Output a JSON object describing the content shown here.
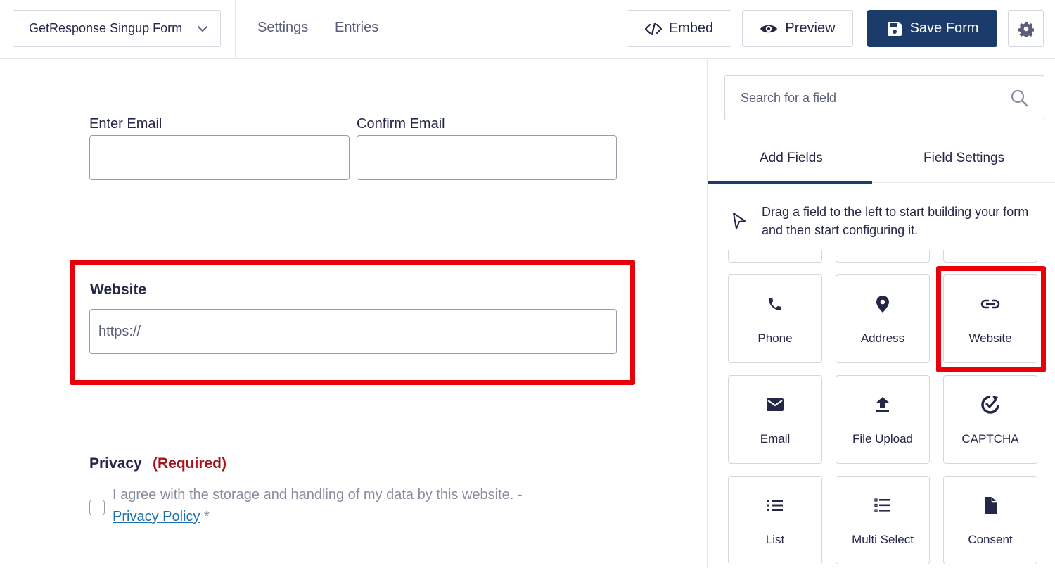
{
  "topbar": {
    "form_name": "GetResponse Singup Form",
    "settings_link": "Settings",
    "entries_link": "Entries",
    "embed_label": "Embed",
    "preview_label": "Preview",
    "save_label": "Save Form"
  },
  "canvas": {
    "email_label": "Enter Email",
    "confirm_email_label": "Confirm Email",
    "website_label": "Website",
    "website_placeholder": "https://",
    "privacy_label": "Privacy",
    "privacy_required": "(Required)",
    "consent_text": "I agree with the storage and handling of my data by this website. -",
    "privacy_policy_link": "Privacy Policy",
    "consent_asterisk": "*"
  },
  "sidebar": {
    "search_placeholder": "Search for a field",
    "tab_add_fields": "Add Fields",
    "tab_field_settings": "Field Settings",
    "hint": "Drag a field to the left to start building your form and then start configuring it.",
    "fields": [
      {
        "label": "Phone",
        "icon": "phone-icon"
      },
      {
        "label": "Address",
        "icon": "map-pin-icon"
      },
      {
        "label": "Website",
        "icon": "link-icon"
      },
      {
        "label": "Email",
        "icon": "envelope-icon"
      },
      {
        "label": "File Upload",
        "icon": "upload-icon"
      },
      {
        "label": "CAPTCHA",
        "icon": "captcha-icon"
      },
      {
        "label": "List",
        "icon": "list-icon"
      },
      {
        "label": "Multi Select",
        "icon": "multi-select-icon"
      },
      {
        "label": "Consent",
        "icon": "document-icon"
      }
    ]
  },
  "colors": {
    "primary": "#1b3c6b",
    "highlight": "#e8000b",
    "required": "#a3141b",
    "link": "#1c6fb0"
  }
}
